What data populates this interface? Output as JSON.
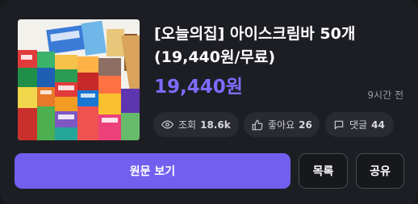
{
  "post": {
    "title_line1": "[오늘의집] 아이스크림바 50개",
    "title_line2": "(19,440원/무료)",
    "price": "19,440원",
    "time_ago": "9시간 전",
    "image_alt": "assorted ice cream bar packages"
  },
  "stats": {
    "views_label": "조회",
    "views_value": "18.6k",
    "likes_label": "좋아요",
    "likes_value": "26",
    "comments_label": "댓글",
    "comments_value": "44"
  },
  "actions": {
    "view_original": "원문 보기",
    "list": "목록",
    "share": "공유"
  },
  "colors": {
    "accent": "#735fef",
    "price": "#7f6bff",
    "background": "#1d1e23"
  },
  "icons": {
    "views": "eye-icon",
    "likes": "thumbs-up-icon",
    "comments": "comment-icon"
  }
}
